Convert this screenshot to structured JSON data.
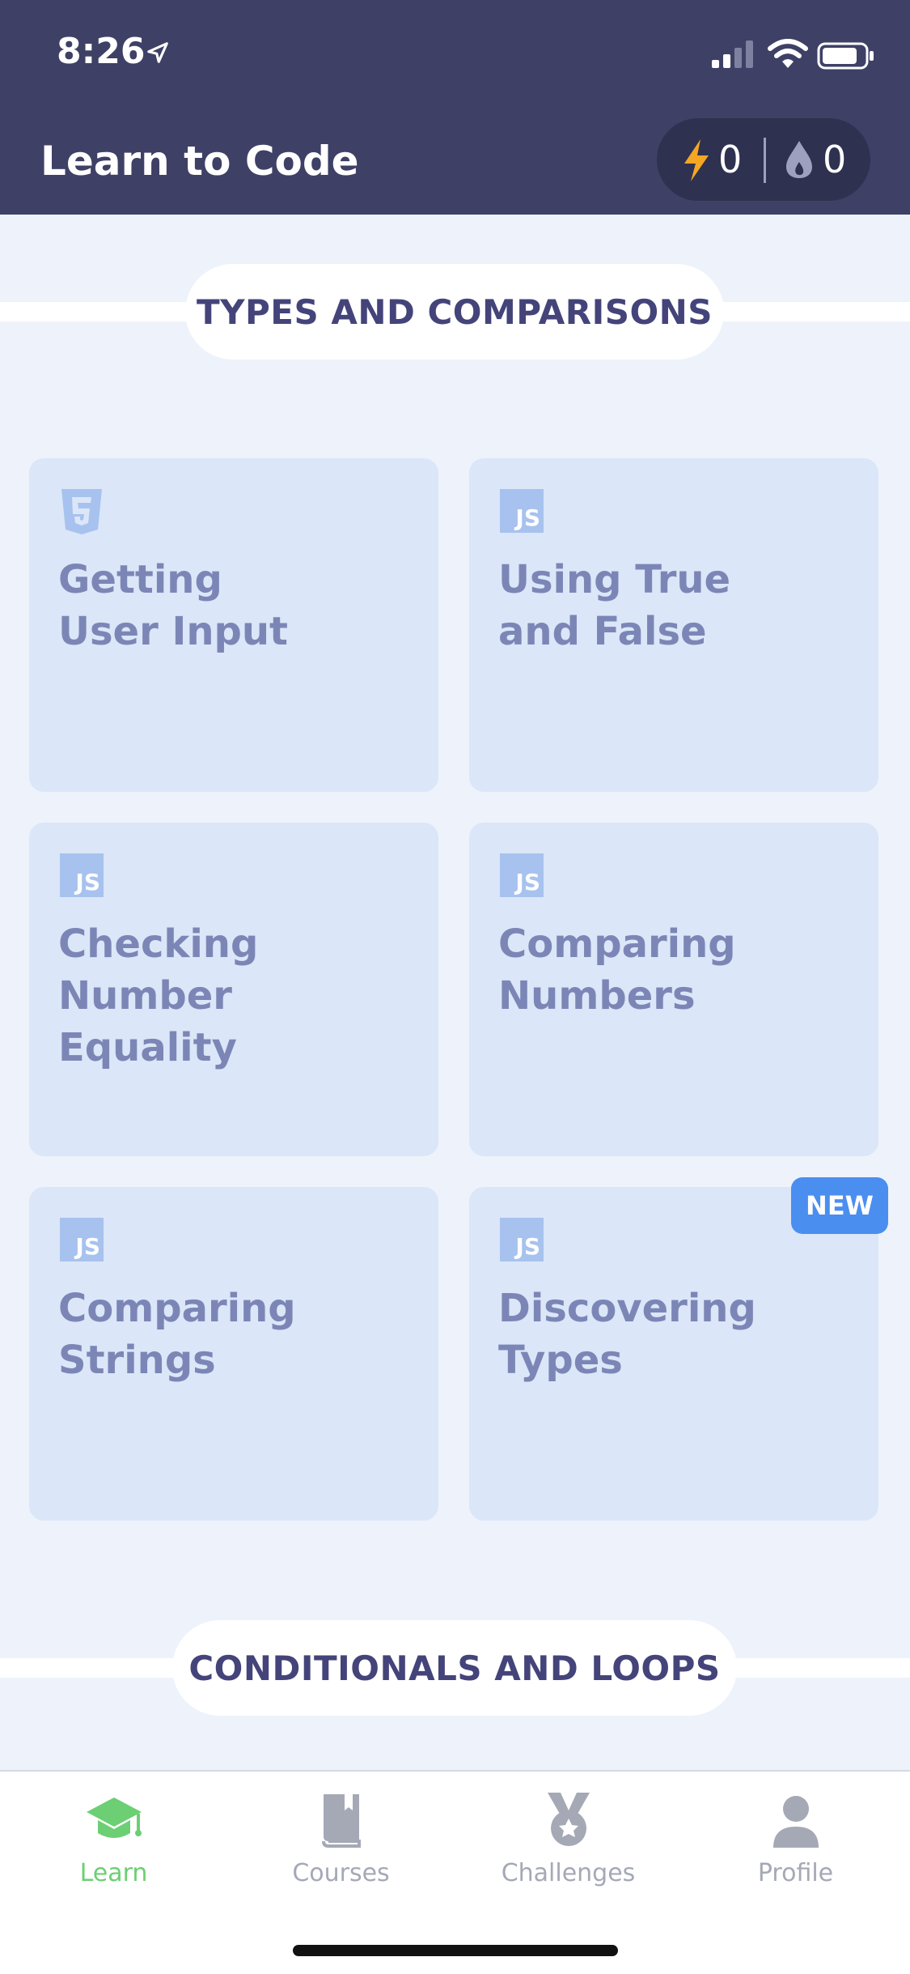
{
  "status_bar": {
    "time": "8:26"
  },
  "header": {
    "title": "Learn to Code",
    "stats": {
      "energy": "0",
      "streak": "0"
    }
  },
  "sections": [
    {
      "title": "TYPES AND COMPARISONS"
    },
    {
      "title": "CONDITIONALS AND LOOPS"
    }
  ],
  "lessons": [
    {
      "title_line1": "Getting",
      "title_line2": "User Input",
      "icon": "html5-icon"
    },
    {
      "title_line1": "Using True",
      "title_line2": "and False",
      "icon": "js-icon",
      "badge_text": "JS"
    },
    {
      "title_line1": "Checking",
      "title_line2": "Number Equality",
      "icon": "js-icon",
      "badge_text": "JS"
    },
    {
      "title_line1": "Comparing",
      "title_line2": "Numbers",
      "icon": "js-icon",
      "badge_text": "JS"
    },
    {
      "title_line1": "Comparing",
      "title_line2": "Strings",
      "icon": "js-icon",
      "badge_text": "JS"
    },
    {
      "title_line1": "Discovering",
      "title_line2": "Types",
      "icon": "js-icon",
      "badge_text": "JS",
      "badge": "NEW"
    }
  ],
  "tabs": [
    {
      "label": "Learn",
      "icon": "graduation-cap-icon",
      "active": true
    },
    {
      "label": "Courses",
      "icon": "book-icon",
      "active": false
    },
    {
      "label": "Challenges",
      "icon": "medal-icon",
      "active": false
    },
    {
      "label": "Profile",
      "icon": "person-icon",
      "active": false
    }
  ],
  "colors": {
    "header_bg": "#3e4066",
    "card_bg": "#dbe6f8",
    "accent_green": "#6ccf73",
    "new_badge": "#4a8ef0"
  }
}
